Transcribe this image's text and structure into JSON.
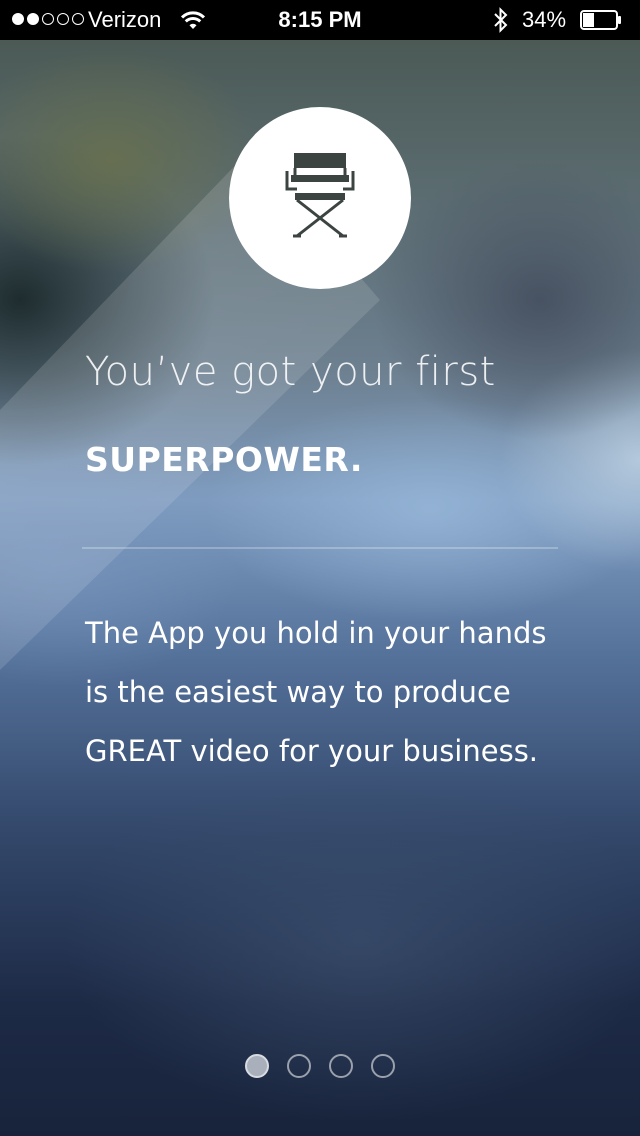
{
  "status_bar": {
    "carrier": "Verizon",
    "signal_bars_filled": 2,
    "signal_bars_total": 5,
    "time": "8:15 PM",
    "battery_percent": "34%",
    "battery_level": 0.34,
    "icons": [
      "wifi-icon",
      "bluetooth-icon",
      "battery-icon"
    ]
  },
  "onboarding": {
    "icon": "directors-chair-icon",
    "headline": "You’ve got your first",
    "subhead": "SUPERPOWER.",
    "body": "The App you hold in your hands is the easiest way to produce GREAT video for your business."
  },
  "pager": {
    "total_pages": 4,
    "current_page": 1
  },
  "colors": {
    "status_bar_bg": "#000000",
    "badge_bg": "#ffffff",
    "icon_color": "#3c4442",
    "text_color": "#ffffff"
  }
}
